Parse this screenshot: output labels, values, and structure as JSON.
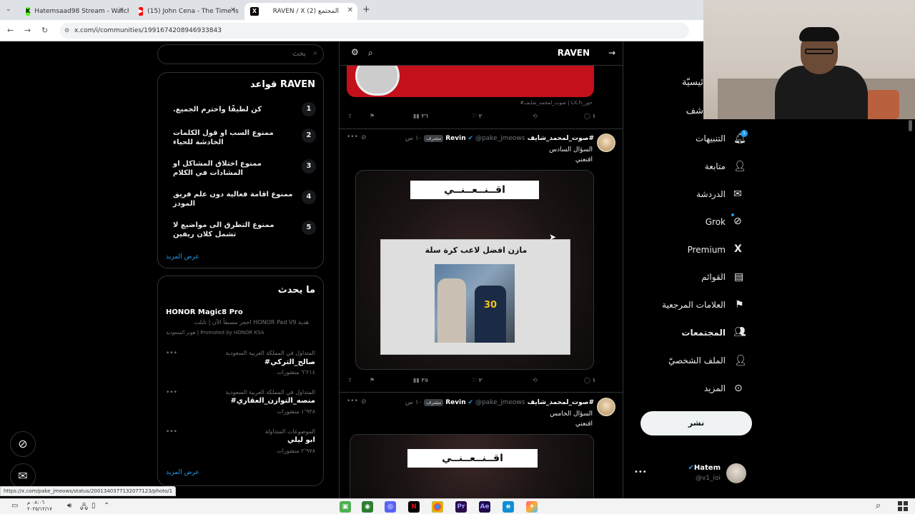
{
  "browser": {
    "tabs": [
      {
        "title": "Hatemsaad98 Stream - Watch L"
      },
      {
        "title": "(15) John Cena - The Time Is N"
      },
      {
        "title": "RAVEN / X (2) المجتمع"
      }
    ],
    "url": "x.com/i/communities/1991674208946933843",
    "status_url": "https://x.com/pake_jmeows/status/2001340377132077123/photo/1"
  },
  "search": {
    "placeholder": "بحث"
  },
  "rules": {
    "title": "قواعد RAVEN",
    "items": [
      {
        "num": "1",
        "text": "كن لطيفًا واحترم الجميع."
      },
      {
        "num": "2",
        "text": "ممنوع السب او قول الكلمات الخادشة للحياء"
      },
      {
        "num": "3",
        "text": "ممنوع اختلاق المشاكل او المشادات في الكلام"
      },
      {
        "num": "4",
        "text": "ممنوع اقامة فعالية دون علم فريق المودز"
      },
      {
        "num": "5",
        "text": "ممنوع التطرق الى مواضيع لا تشمل كلان ريفين"
      }
    ],
    "more": "عرض المزيد"
  },
  "happening": {
    "title": "ما يحدث",
    "ad": {
      "name": "HONOR Magic8 Pro",
      "line1": "هدية HONOR Pad V9  احجز مسبقاً الآن | تابلت",
      "line2": "هونر السعودية | Promoted by HONOR KSA"
    },
    "trends": [
      {
        "context": "المتداول في المملكة العربية السعودية",
        "name": "#صالح_التركي",
        "count": "٦٬٢١٤ منشورات"
      },
      {
        "context": "المتداول في المملكة العربية السعودية",
        "name": "#منصه_التوازن_العقاري",
        "count": "١٬٩٣٨ منشورات"
      },
      {
        "context": "الموضوعات المتداولة",
        "name": "ابو ليلي",
        "count": "٢٬٩٧٨ منشورات"
      }
    ],
    "more": "عرض المزيد"
  },
  "feed": {
    "title": "RAVEN",
    "top_caption": "حور_LX.h | صوت_لمحمد_شايف#",
    "top_actions": {
      "views": "٣٦",
      "likes": "٢",
      "replies": "١"
    },
    "posts": [
      {
        "name": "#صوت_لمحمد_شايف Revin",
        "handle": "@pake_jmeows",
        "badge": "مشرف",
        "time": "١٠ س",
        "line1": "السؤال السادس",
        "line2": "اقنعني",
        "img_title": "اقــنــعــنــي",
        "img_question": "مازن افضل لاعب كرة سلة",
        "jersey": "30",
        "actions": {
          "views": "٣٥",
          "likes": "٢",
          "replies": "١"
        }
      },
      {
        "name": "#صوت_لمحمد_شايف Revin",
        "handle": "@pake_jmeows",
        "badge": "مشرف",
        "time": "١٠ س",
        "line1": "السؤال الخامس",
        "line2": "اقنعني",
        "img_title": "اقــنــعــنــي"
      }
    ]
  },
  "nav": {
    "items": [
      {
        "label": "التنبيهات"
      },
      {
        "label": "متابعة"
      },
      {
        "label": "الدردشة"
      },
      {
        "label": "Grok"
      },
      {
        "label": "Premium"
      },
      {
        "label": "القوائم"
      },
      {
        "label": "العلامات المرجعية"
      },
      {
        "label": "المجتمعات"
      },
      {
        "label": "الملف الشخصيّ"
      },
      {
        "label": "المزيد"
      }
    ],
    "partial1": "ئيسيّة",
    "partial2": "شف",
    "post_button": "نشر",
    "notif_count": "1"
  },
  "account": {
    "name": "Hatem",
    "handle": "@v1_ioi"
  },
  "taskbar": {
    "time": "٠٨:٠٦ م",
    "date": "٢٠٢٥/١٢/١٧"
  }
}
